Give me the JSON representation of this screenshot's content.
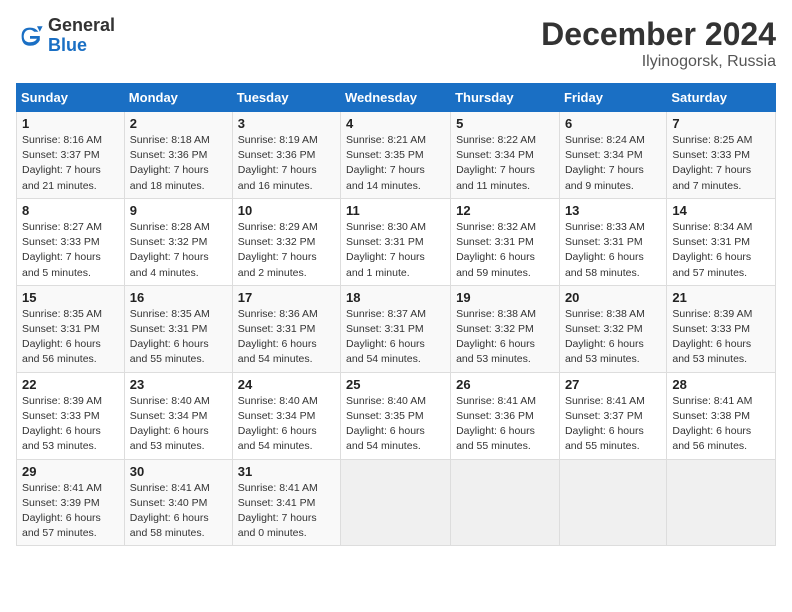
{
  "header": {
    "logo_general": "General",
    "logo_blue": "Blue",
    "month_title": "December 2024",
    "location": "Ilyinogorsk, Russia"
  },
  "weekdays": [
    "Sunday",
    "Monday",
    "Tuesday",
    "Wednesday",
    "Thursday",
    "Friday",
    "Saturday"
  ],
  "weeks": [
    [
      {
        "day": "1",
        "sunrise": "8:16 AM",
        "sunset": "3:37 PM",
        "daylight": "7 hours and 21 minutes."
      },
      {
        "day": "2",
        "sunrise": "8:18 AM",
        "sunset": "3:36 PM",
        "daylight": "7 hours and 18 minutes."
      },
      {
        "day": "3",
        "sunrise": "8:19 AM",
        "sunset": "3:36 PM",
        "daylight": "7 hours and 16 minutes."
      },
      {
        "day": "4",
        "sunrise": "8:21 AM",
        "sunset": "3:35 PM",
        "daylight": "7 hours and 14 minutes."
      },
      {
        "day": "5",
        "sunrise": "8:22 AM",
        "sunset": "3:34 PM",
        "daylight": "7 hours and 11 minutes."
      },
      {
        "day": "6",
        "sunrise": "8:24 AM",
        "sunset": "3:34 PM",
        "daylight": "7 hours and 9 minutes."
      },
      {
        "day": "7",
        "sunrise": "8:25 AM",
        "sunset": "3:33 PM",
        "daylight": "7 hours and 7 minutes."
      }
    ],
    [
      {
        "day": "8",
        "sunrise": "8:27 AM",
        "sunset": "3:33 PM",
        "daylight": "7 hours and 5 minutes."
      },
      {
        "day": "9",
        "sunrise": "8:28 AM",
        "sunset": "3:32 PM",
        "daylight": "7 hours and 4 minutes."
      },
      {
        "day": "10",
        "sunrise": "8:29 AM",
        "sunset": "3:32 PM",
        "daylight": "7 hours and 2 minutes."
      },
      {
        "day": "11",
        "sunrise": "8:30 AM",
        "sunset": "3:31 PM",
        "daylight": "7 hours and 1 minute."
      },
      {
        "day": "12",
        "sunrise": "8:32 AM",
        "sunset": "3:31 PM",
        "daylight": "6 hours and 59 minutes."
      },
      {
        "day": "13",
        "sunrise": "8:33 AM",
        "sunset": "3:31 PM",
        "daylight": "6 hours and 58 minutes."
      },
      {
        "day": "14",
        "sunrise": "8:34 AM",
        "sunset": "3:31 PM",
        "daylight": "6 hours and 57 minutes."
      }
    ],
    [
      {
        "day": "15",
        "sunrise": "8:35 AM",
        "sunset": "3:31 PM",
        "daylight": "6 hours and 56 minutes."
      },
      {
        "day": "16",
        "sunrise": "8:35 AM",
        "sunset": "3:31 PM",
        "daylight": "6 hours and 55 minutes."
      },
      {
        "day": "17",
        "sunrise": "8:36 AM",
        "sunset": "3:31 PM",
        "daylight": "6 hours and 54 minutes."
      },
      {
        "day": "18",
        "sunrise": "8:37 AM",
        "sunset": "3:31 PM",
        "daylight": "6 hours and 54 minutes."
      },
      {
        "day": "19",
        "sunrise": "8:38 AM",
        "sunset": "3:32 PM",
        "daylight": "6 hours and 53 minutes."
      },
      {
        "day": "20",
        "sunrise": "8:38 AM",
        "sunset": "3:32 PM",
        "daylight": "6 hours and 53 minutes."
      },
      {
        "day": "21",
        "sunrise": "8:39 AM",
        "sunset": "3:33 PM",
        "daylight": "6 hours and 53 minutes."
      }
    ],
    [
      {
        "day": "22",
        "sunrise": "8:39 AM",
        "sunset": "3:33 PM",
        "daylight": "6 hours and 53 minutes."
      },
      {
        "day": "23",
        "sunrise": "8:40 AM",
        "sunset": "3:34 PM",
        "daylight": "6 hours and 53 minutes."
      },
      {
        "day": "24",
        "sunrise": "8:40 AM",
        "sunset": "3:34 PM",
        "daylight": "6 hours and 54 minutes."
      },
      {
        "day": "25",
        "sunrise": "8:40 AM",
        "sunset": "3:35 PM",
        "daylight": "6 hours and 54 minutes."
      },
      {
        "day": "26",
        "sunrise": "8:41 AM",
        "sunset": "3:36 PM",
        "daylight": "6 hours and 55 minutes."
      },
      {
        "day": "27",
        "sunrise": "8:41 AM",
        "sunset": "3:37 PM",
        "daylight": "6 hours and 55 minutes."
      },
      {
        "day": "28",
        "sunrise": "8:41 AM",
        "sunset": "3:38 PM",
        "daylight": "6 hours and 56 minutes."
      }
    ],
    [
      {
        "day": "29",
        "sunrise": "8:41 AM",
        "sunset": "3:39 PM",
        "daylight": "6 hours and 57 minutes."
      },
      {
        "day": "30",
        "sunrise": "8:41 AM",
        "sunset": "3:40 PM",
        "daylight": "6 hours and 58 minutes."
      },
      {
        "day": "31",
        "sunrise": "8:41 AM",
        "sunset": "3:41 PM",
        "daylight": "7 hours and 0 minutes."
      },
      null,
      null,
      null,
      null
    ]
  ]
}
